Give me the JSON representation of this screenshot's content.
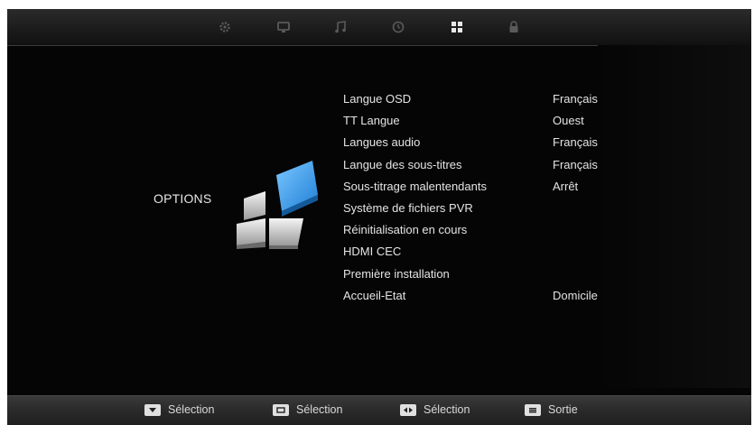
{
  "top_tabs": [
    {
      "icon": "gear-icon",
      "active": false
    },
    {
      "icon": "monitor-icon",
      "active": false
    },
    {
      "icon": "music-note-icon",
      "active": false
    },
    {
      "icon": "clock-icon",
      "active": false
    },
    {
      "icon": "grid-icon",
      "active": true
    },
    {
      "icon": "lock-icon",
      "active": false
    }
  ],
  "page_title": "OPTIONS",
  "menu": [
    {
      "label": "Langue OSD",
      "value": "Français"
    },
    {
      "label": "TT Langue",
      "value": "Ouest"
    },
    {
      "label": "Langues audio",
      "value": "Français"
    },
    {
      "label": "Langue des sous-titres",
      "value": "Français"
    },
    {
      "label": "Sous-titrage malentendants",
      "value": "Arrêt"
    },
    {
      "label": "Système de fichiers PVR",
      "value": ""
    },
    {
      "label": "Réinitialisation en cours",
      "value": ""
    },
    {
      "label": "HDMI CEC",
      "value": ""
    },
    {
      "label": "Première installation",
      "value": ""
    },
    {
      "label": "Accueil-Etat",
      "value": "Domicile"
    }
  ],
  "bottom_hints": [
    {
      "key": "down-key-icon",
      "label": "Sélection"
    },
    {
      "key": "ok-key-icon",
      "label": "Sélection"
    },
    {
      "key": "left-right-key-icon",
      "label": "Sélection"
    },
    {
      "key": "menu-key-icon",
      "label": "Sortie"
    }
  ],
  "colors": {
    "background": "#050505",
    "accent": "#3aa0e8",
    "text": "#e4e4e4"
  }
}
